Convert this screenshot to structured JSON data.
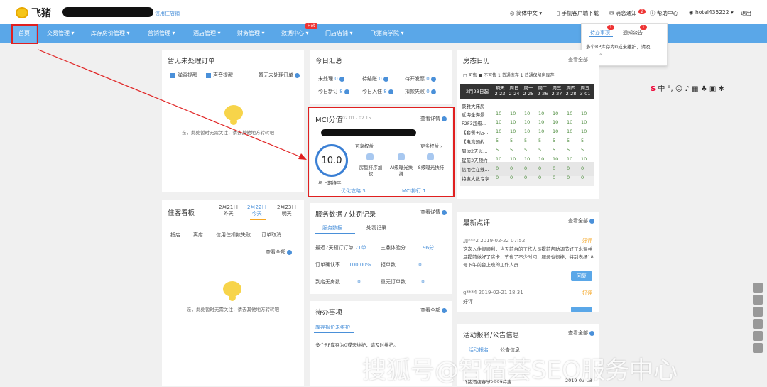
{
  "header": {
    "logo_text": "飞猪",
    "store_link": "信用住店铺",
    "lang": "简体中文",
    "mobile": "手机客户端下载",
    "msg": "消息通知",
    "msg_count": "2",
    "help": "帮助中心",
    "user": "hotel435222",
    "logout": "退出"
  },
  "nav": {
    "home": "首页",
    "items": [
      "交易管理",
      "库存房价管理",
      "营销管理",
      "酒店管理",
      "财务管理",
      "数据中心",
      "门店店铺",
      "飞猪商学院"
    ],
    "hot": "Hot"
  },
  "popup": {
    "tab1": "待办事项",
    "tab1_badge": "1",
    "tab2": "通知公告",
    "tab2_badge": "1",
    "item": "多个RP库存为0或未维护，请及时维护。",
    "count": "1"
  },
  "orders": {
    "title": "暂无未处理订单",
    "opt1": "弹窗提醒",
    "opt2": "声音提醒",
    "more": "暂无未处理订单",
    "empty": "亲，此处暂时无需关注，请去其他地方转转吧"
  },
  "summary": {
    "title": "今日汇总",
    "rows": [
      [
        {
          "k": "未处理",
          "v": "0"
        },
        {
          "k": "待结账",
          "v": "0"
        },
        {
          "k": "待开发票",
          "v": "0"
        }
      ],
      [
        {
          "k": "今日新订",
          "v": "8"
        },
        {
          "k": "今日入住",
          "v": "8"
        },
        {
          "k": "扣款失败",
          "v": "0"
        }
      ]
    ]
  },
  "mci": {
    "title": "MCI分值",
    "dates": "02.01 - 02.15",
    "more": "查看详情",
    "score": "10.0",
    "compare": "与上期持平",
    "rights": "可享权益",
    "more_rights": "更多权益",
    "r1": "房型排序加权",
    "r2": "AI级曝光扶持",
    "r3": "S级曝光扶持",
    "link1": "优化攻略 3",
    "link2": "MCI排行 1"
  },
  "calendar": {
    "title": "房态日历",
    "more": "查看全部",
    "legend": [
      "可售",
      "不可售",
      "1",
      "普通库存",
      "1",
      "普通保留房库存"
    ],
    "date_label": "2月23日起",
    "days": [
      {
        "d": "明天",
        "n": "2-23"
      },
      {
        "d": "周日",
        "n": "2-24"
      },
      {
        "d": "周一",
        "n": "2-25"
      },
      {
        "d": "周二",
        "n": "2-26"
      },
      {
        "d": "周三",
        "n": "2-27"
      },
      {
        "d": "周四",
        "n": "2-28"
      },
      {
        "d": "周五",
        "n": "3-01"
      }
    ],
    "group": "豪雅大床房",
    "rows": [
      "近海全海景...",
      "F2F3超级...",
      "【套餐+店...",
      "【电竞预约...",
      "周边2天以...",
      "提前3天预约",
      "信用住在线...",
      "特惠大数专享"
    ]
  },
  "guest": {
    "title": "住客看板",
    "dates": [
      {
        "a": "2月21日",
        "b": "昨天"
      },
      {
        "a": "2月22日",
        "b": "今天"
      },
      {
        "a": "2月23日",
        "b": "明天"
      }
    ],
    "cols": [
      "抵店",
      "离店",
      "信用住扣款失败",
      "订单取消"
    ],
    "more": "查看全部",
    "empty": "亲，此处暂时无需关注，请去其他地方转转吧"
  },
  "service": {
    "title": "服务数据 / 处罚记录",
    "more": "查看详情",
    "tab1": "服务数据",
    "tab2": "处罚记录",
    "rows": [
      [
        {
          "k": "最近7天预订订单",
          "v": "71单"
        },
        {
          "k": "三鼎体验分",
          "v": "96分"
        }
      ],
      [
        {
          "k": "订单确认率",
          "v": "100.00%"
        },
        {
          "k": "拒单数",
          "v": "0"
        }
      ],
      [
        {
          "k": "到店无房数",
          "v": "0"
        },
        {
          "k": "重无订单数",
          "v": "0"
        }
      ]
    ]
  },
  "todo": {
    "title": "待办事项",
    "more": "查看全部",
    "tab": "库存报价未维护",
    "item": "多个RP库存为0或未维护，请及时维护。"
  },
  "reviews": {
    "title": "最新点评",
    "more": "查看全部",
    "r1_user": "加***2",
    "r1_time": "2019-02-22 07:52",
    "r1_tag": "好评",
    "r1_text": "这次入住很顺利，当天前台的工作人员提前帮助调节好了水温并且提前做好了房卡，节省了不少时间，服务也很棒，特别表扬18号下午前台上班的工作人员",
    "reply": "回复",
    "r2_user": "g***4",
    "r2_time": "2019-02-21 18:31",
    "r2_tag": "好评",
    "r2_text": "好评"
  },
  "activity": {
    "title": "活动报名/公告信息",
    "more": "查看全部",
    "tab1": "活动报名",
    "tab2": "公告信息",
    "item": "飞猪酒店春节2999特惠",
    "date": "2019-03-08"
  },
  "watermark": "搜狐号@智宿荟SEO服务中心",
  "colors": {
    "accent": "#5aa7e8",
    "highlight": "#e02020"
  }
}
